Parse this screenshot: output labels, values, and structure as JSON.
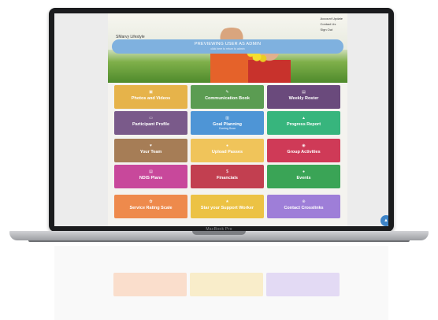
{
  "site": {
    "logo_text": "SMarvy Lifestyle",
    "top_links": [
      "Account Update",
      "Contact Us",
      "Sign Out"
    ],
    "banner_title": "PREVIEWING USER AS ADMIN",
    "banner_sub": "click here to return to admin"
  },
  "tiles_row1": [
    {
      "icon": "photo-icon",
      "glyph": "▣",
      "label": "Photos and Videos",
      "sub": "",
      "color": "#e6b34a"
    },
    {
      "icon": "chat-icon",
      "glyph": "✎",
      "label": "Communication Book",
      "sub": "",
      "color": "#5b9c52"
    },
    {
      "icon": "calendar-icon",
      "glyph": "▤",
      "label": "Weekly Roster",
      "sub": "",
      "color": "#6a4a7c"
    },
    {
      "icon": "id-card-icon",
      "glyph": "▭",
      "label": "Participant Profile",
      "sub": "",
      "color": "#7a5a8a"
    },
    {
      "icon": "bar-chart-icon",
      "glyph": "▥",
      "label": "Goal Planning",
      "sub": "Coming Soon",
      "color": "#4e95d6"
    },
    {
      "icon": "trend-icon",
      "glyph": "▲",
      "label": "Progress Report",
      "sub": "",
      "color": "#37b57d"
    }
  ],
  "tiles_row2": [
    {
      "icon": "team-icon",
      "glyph": "♥",
      "label": "Your Team",
      "sub": "",
      "color": "#a67d56"
    },
    {
      "icon": "upload-icon",
      "glyph": "●",
      "label": "Upload Passes",
      "sub": "",
      "color": "#f0c45a"
    },
    {
      "icon": "activity-icon",
      "glyph": "◉",
      "label": "Group Activities",
      "sub": "",
      "color": "#cf3a57"
    },
    {
      "icon": "document-icon",
      "glyph": "▤",
      "label": "NDIS Plans",
      "sub": "",
      "color": "#c8489b"
    },
    {
      "icon": "dollar-icon",
      "glyph": "$",
      "label": "Financials",
      "sub": "",
      "color": "#c23f50"
    },
    {
      "icon": "events-icon",
      "glyph": "●",
      "label": "Events",
      "sub": "",
      "color": "#3aa456"
    }
  ],
  "tiles_row3": [
    {
      "icon": "rating-icon",
      "glyph": "✿",
      "label": "Service Rating Scale",
      "sub": "",
      "color": "#ee8a4c"
    },
    {
      "icon": "star-icon",
      "glyph": "★",
      "label": "Star your Support Worker",
      "sub": "",
      "color": "#ecc244"
    },
    {
      "icon": "link-icon",
      "glyph": "⊕",
      "label": "Contact Crosslinks",
      "sub": "",
      "color": "#9e7ed8"
    }
  ],
  "laptop": {
    "brand": "MacBook Pro"
  },
  "fab": {
    "glyph": "▲"
  }
}
